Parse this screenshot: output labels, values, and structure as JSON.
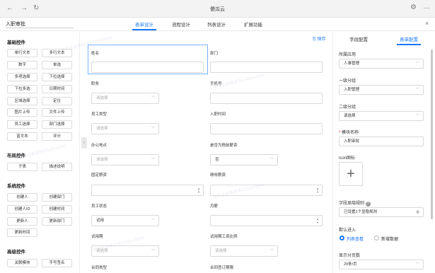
{
  "window": {
    "title": "傻瓜云",
    "nav_back": "←",
    "nav_forward": "→",
    "nav_refresh": "↻",
    "menu": "…",
    "close": "×",
    "gear": "⚙"
  },
  "form": {
    "name": "入职审批"
  },
  "tabs": [
    {
      "label": "表单设计"
    },
    {
      "label": "流程设计"
    },
    {
      "label": "列表设计"
    },
    {
      "label": "扩展功能"
    }
  ],
  "toolbar": {
    "save": "保存",
    "field_config": "字段配置",
    "form_config": "表单配置"
  },
  "sidebar": {
    "toggle_glyph": "‹",
    "sections": [
      {
        "title": "基础控件",
        "items": [
          "单行文本",
          "多行文本",
          "数字",
          "单选",
          "多项选择",
          "下拉选择",
          "下拉多选",
          "日期时间",
          "区域选择",
          "定位",
          "图片上传",
          "文件上传",
          "员工选择",
          "部门选择",
          "富文本",
          "评分"
        ]
      },
      {
        "title": "布局控件",
        "items": [
          "子表",
          "描述说明"
        ]
      },
      {
        "title": "系统控件",
        "items": [
          "创建人",
          "创建部门",
          "创建人ID",
          "创建时间",
          "更新人",
          "更新部门",
          "更新时间"
        ]
      },
      {
        "title": "高级控件",
        "items": [
          "关联模块",
          "手写签名"
        ]
      }
    ]
  },
  "fields": [
    {
      "label": "姓名",
      "kind": "input",
      "value": ""
    },
    {
      "label": "部门",
      "kind": "input",
      "value": ""
    },
    {
      "label": "职务",
      "kind": "select",
      "value": "请选择"
    },
    {
      "label": "手机号",
      "kind": "input",
      "value": ""
    },
    {
      "label": "员工类型",
      "kind": "select",
      "value": "请选择"
    },
    {
      "label": "入职时间",
      "kind": "input",
      "value": ""
    },
    {
      "label": "办公地点",
      "kind": "select",
      "value": "请选择"
    },
    {
      "label": "是否为税前薪资",
      "kind": "select",
      "value": "否"
    },
    {
      "label": "固定薪资",
      "kind": "number",
      "value": ""
    },
    {
      "label": "绩效薪资",
      "kind": "number",
      "value": ""
    },
    {
      "label": "员工状态",
      "kind": "select",
      "value": "试用"
    },
    {
      "label": "月薪",
      "kind": "number",
      "value": ""
    },
    {
      "label": "试用期",
      "kind": "select",
      "value": "请选择"
    },
    {
      "label": "试用期工资比例",
      "kind": "select",
      "value": "请选择"
    },
    {
      "label": "合同类型",
      "kind": "select",
      "value": ""
    },
    {
      "label": "合同签订期限",
      "kind": "select",
      "value": ""
    }
  ],
  "config": {
    "app_label": "所属应用",
    "app_value": "人事管理",
    "group1_label": "一级分组",
    "group1_value": "入职管理",
    "group2_label": "二级分组",
    "group2_value": "请选择",
    "module_label": "模块名称",
    "module_value": "入职审批",
    "required_mark": "*",
    "icon_label": "icon图标",
    "icon_plus": "+",
    "hide_rule_label": "字段显隐规则",
    "help_glyph": "?",
    "hide_rule_value": "已设置1个显隐规则",
    "default_entry_label": "默认进入",
    "default_entry_options": [
      "列表查看",
      "新增数据"
    ],
    "page_size_label": "显示分页数",
    "page_size_value": "20条/页"
  },
  "watermark": "张中文@新研发43454 4054"
}
